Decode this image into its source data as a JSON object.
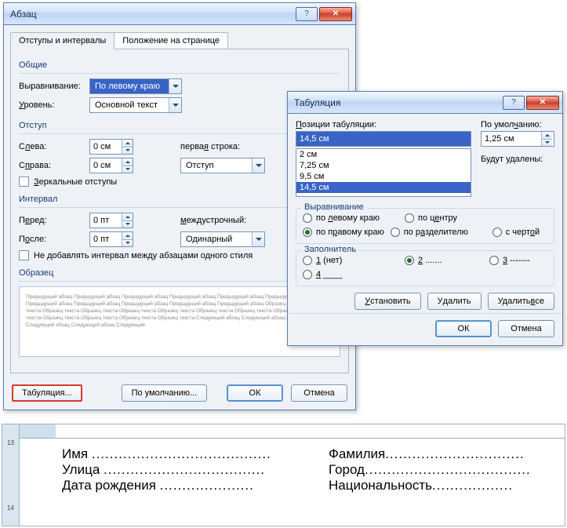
{
  "paragraph": {
    "title": "Абзац",
    "tabs": {
      "active": "Отступы и интервалы",
      "inactive": "Положение на странице"
    },
    "general": {
      "group": "Общие",
      "align_label": "Выравнивание:",
      "align_value": "По левому краю",
      "level_label": "Уровень:",
      "level_value": "Основной текст"
    },
    "indent": {
      "group": "Отступ",
      "left_label": "Слева:",
      "left_value": "0 см",
      "right_label": "Справа:",
      "right_value": "0 см",
      "firstline_label": "первая строка:",
      "firstline_value": "Отступ",
      "mirror": "Зеркальные отступы"
    },
    "spacing": {
      "group": "Интервал",
      "before_label": "Перед:",
      "before_value": "0 пт",
      "after_label": "После:",
      "after_value": "0 пт",
      "line_label": "междустрочный:",
      "line_value": "Одинарный",
      "nosame": "Не добавлять интервал между абзацами одного стиля"
    },
    "sample": {
      "label": "Образец",
      "text": "Предыдущий абзац Предыдущий абзац Предыдущий абзац Предыдущий абзац Предыдущий абзац Предыдущий абзац Предыдущий абзац Предыдущий абзац Предыдущий абзац Предыдущий абзац Предыдущий абзац\n\nОбразец текста Образец текста Образец текста Образец текста Образец текста Образец текста Образец текста Образец текста Образец текста Образец текста Образец текста Образец текста Образец текста Образец текста\n\nСледующий абзац Следующий абзац Следующий абзац Следующий абзац Следующий абзац Следующий"
    },
    "buttons": {
      "tabs": "Табуляция...",
      "default": "По умолчанию...",
      "ok": "ОК",
      "cancel": "Отмена"
    }
  },
  "tabstops": {
    "title": "Табуляция",
    "pos_label": "Позиции табуляции:",
    "pos_value": "14,5 см",
    "default_label": "По умолчанию:",
    "default_value": "1,25 см",
    "remove_label": "Будут удалены:",
    "list": [
      "2 см",
      "7,25 см",
      "9,5 см",
      "14,5 см"
    ],
    "list_selected": "14,5 см",
    "align": {
      "group": "Выравнивание",
      "left": "по левому краю",
      "center": "по центру",
      "right": "по правому краю",
      "sep": "по разделителю",
      "bar": "с чертой"
    },
    "leader": {
      "group": "Заполнитель",
      "opt1": "1 (нет)",
      "opt2": "2 .......",
      "opt3": "3 -------",
      "opt4": "4 ____"
    },
    "buttons": {
      "set": "Установить",
      "del": "Удалить",
      "delall": "Удалить все",
      "ok": "ОК",
      "cancel": "Отмена"
    }
  },
  "doc": {
    "vruler": [
      "13",
      "",
      "14"
    ],
    "rows": [
      {
        "c1a": "Имя ",
        "c1b": "........................................",
        "c2a": "Фамилия",
        "c2b": "..............................."
      },
      {
        "c1a": "Улица ",
        "c1b": "....................................",
        "c2a": "Город",
        "c2b": "....................................."
      },
      {
        "c1a": "Дата рождения ",
        "c1b": ".....................",
        "c2a": "Национальность",
        "c2b": ".................."
      }
    ]
  }
}
